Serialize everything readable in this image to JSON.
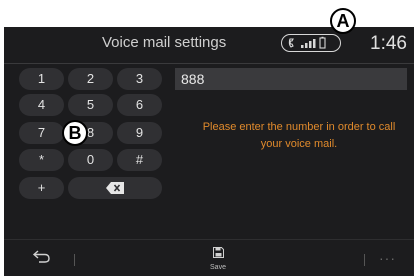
{
  "header": {
    "title": "Voice mail settings",
    "clock": "1:46",
    "status_icons": [
      "phone-icon",
      "signal-bars-icon",
      "battery-icon"
    ]
  },
  "callouts": {
    "a": "A",
    "b": "B"
  },
  "keypad": {
    "rows": [
      [
        "1",
        "2",
        "3"
      ],
      [
        "4",
        "5",
        "6"
      ],
      [
        "7",
        "8",
        "9"
      ],
      [
        "*",
        "0",
        "#"
      ]
    ],
    "plus": "+",
    "delete_icon": "backspace-icon"
  },
  "number_field": {
    "value": "888"
  },
  "hint": {
    "text": "Please enter the number in order to call your voice mail."
  },
  "footer": {
    "back_icon": "back-arrow-icon",
    "save_icon": "save-icon",
    "save_label": "Save",
    "more_label": "···"
  },
  "colors": {
    "background": "#1c1c1e",
    "key": "#303033",
    "hint": "#e08a2c"
  }
}
